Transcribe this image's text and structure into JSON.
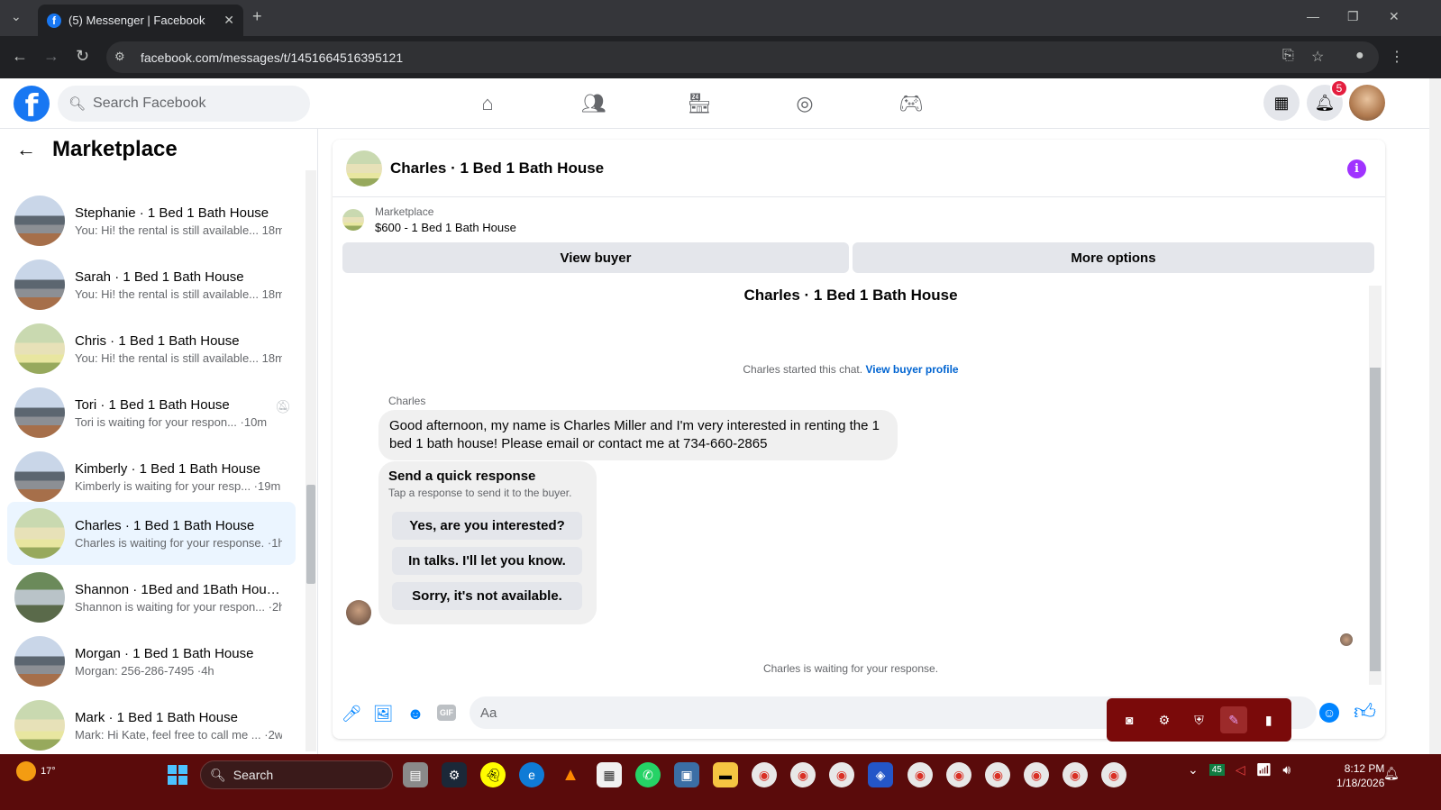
{
  "browser": {
    "tab_title": "(5) Messenger | Facebook",
    "url": "facebook.com/messages/t/1451664516395121"
  },
  "fb": {
    "search_placeholder": "Search Facebook",
    "notification_count": "5"
  },
  "sidebar": {
    "title": "Marketplace",
    "conversations": [
      {
        "name": "Stephanie · 1 Bed 1 Bath House",
        "preview": "You: Hi! the rental is still available... 18m",
        "avatar": "house-g"
      },
      {
        "name": "Sarah · 1 Bed 1 Bath House",
        "preview": "You: Hi! the rental is still available... 18m",
        "avatar": "house-g"
      },
      {
        "name": "Chris · 1 Bed 1 Bath House",
        "preview": "You: Hi! the rental is still available... 18m",
        "avatar": "house-y"
      },
      {
        "name": "Tori · 1 Bed 1 Bath House",
        "preview": "Tori is waiting for your respon... ·10m",
        "avatar": "house-g"
      },
      {
        "name": "Kimberly · 1 Bed 1 Bath House",
        "preview": "Kimberly is waiting for your resp... ·19m",
        "avatar": "house-g"
      },
      {
        "name": "Charles · 1 Bed 1 Bath House",
        "preview": "Charles is waiting for your response. ·1h",
        "avatar": "house-y"
      },
      {
        "name": "Shannon · 1Bed and 1Bath Hous...",
        "preview": "Shannon is waiting for your respon... ·2h",
        "avatar": "house-b"
      },
      {
        "name": "Morgan · 1 Bed 1 Bath House",
        "preview": "Morgan: 256-286-7495 ·4h",
        "avatar": "house-g"
      },
      {
        "name": "Mark · 1 Bed 1 Bath House",
        "preview": "Mark: Hi Kate, feel free to call me ... ·2w",
        "avatar": "house-y"
      }
    ]
  },
  "chat": {
    "title": "Charles · 1 Bed 1 Bath House",
    "marketplace_label": "Marketplace",
    "listing": "$600 - 1 Bed 1 Bath House",
    "view_buyer": "View buyer",
    "more_options": "More options",
    "conversation_title": "Charles · 1 Bed 1 Bath House",
    "started_text": "Charles started this chat.",
    "view_buyer_profile": "View buyer profile",
    "sender": "Charles",
    "message": "Good afternoon,  my name is Charles Miller and I'm very interested in renting the 1 bed 1 bath house! Please email or contact me at 734-660-2865",
    "quick_title": "Send a quick response",
    "quick_sub": "Tap a response to send it to the buyer.",
    "quick_replies": [
      "Yes, are you interested?",
      "In talks. I'll let you know.",
      "Sorry, it's not available."
    ],
    "waiting": "Charles is waiting for your response.",
    "composer_placeholder": "Aa"
  },
  "taskbar": {
    "weather": "17°",
    "search": "Search",
    "time": "8:12 PM",
    "date": "1/18/2026",
    "tray_badge": "45"
  }
}
